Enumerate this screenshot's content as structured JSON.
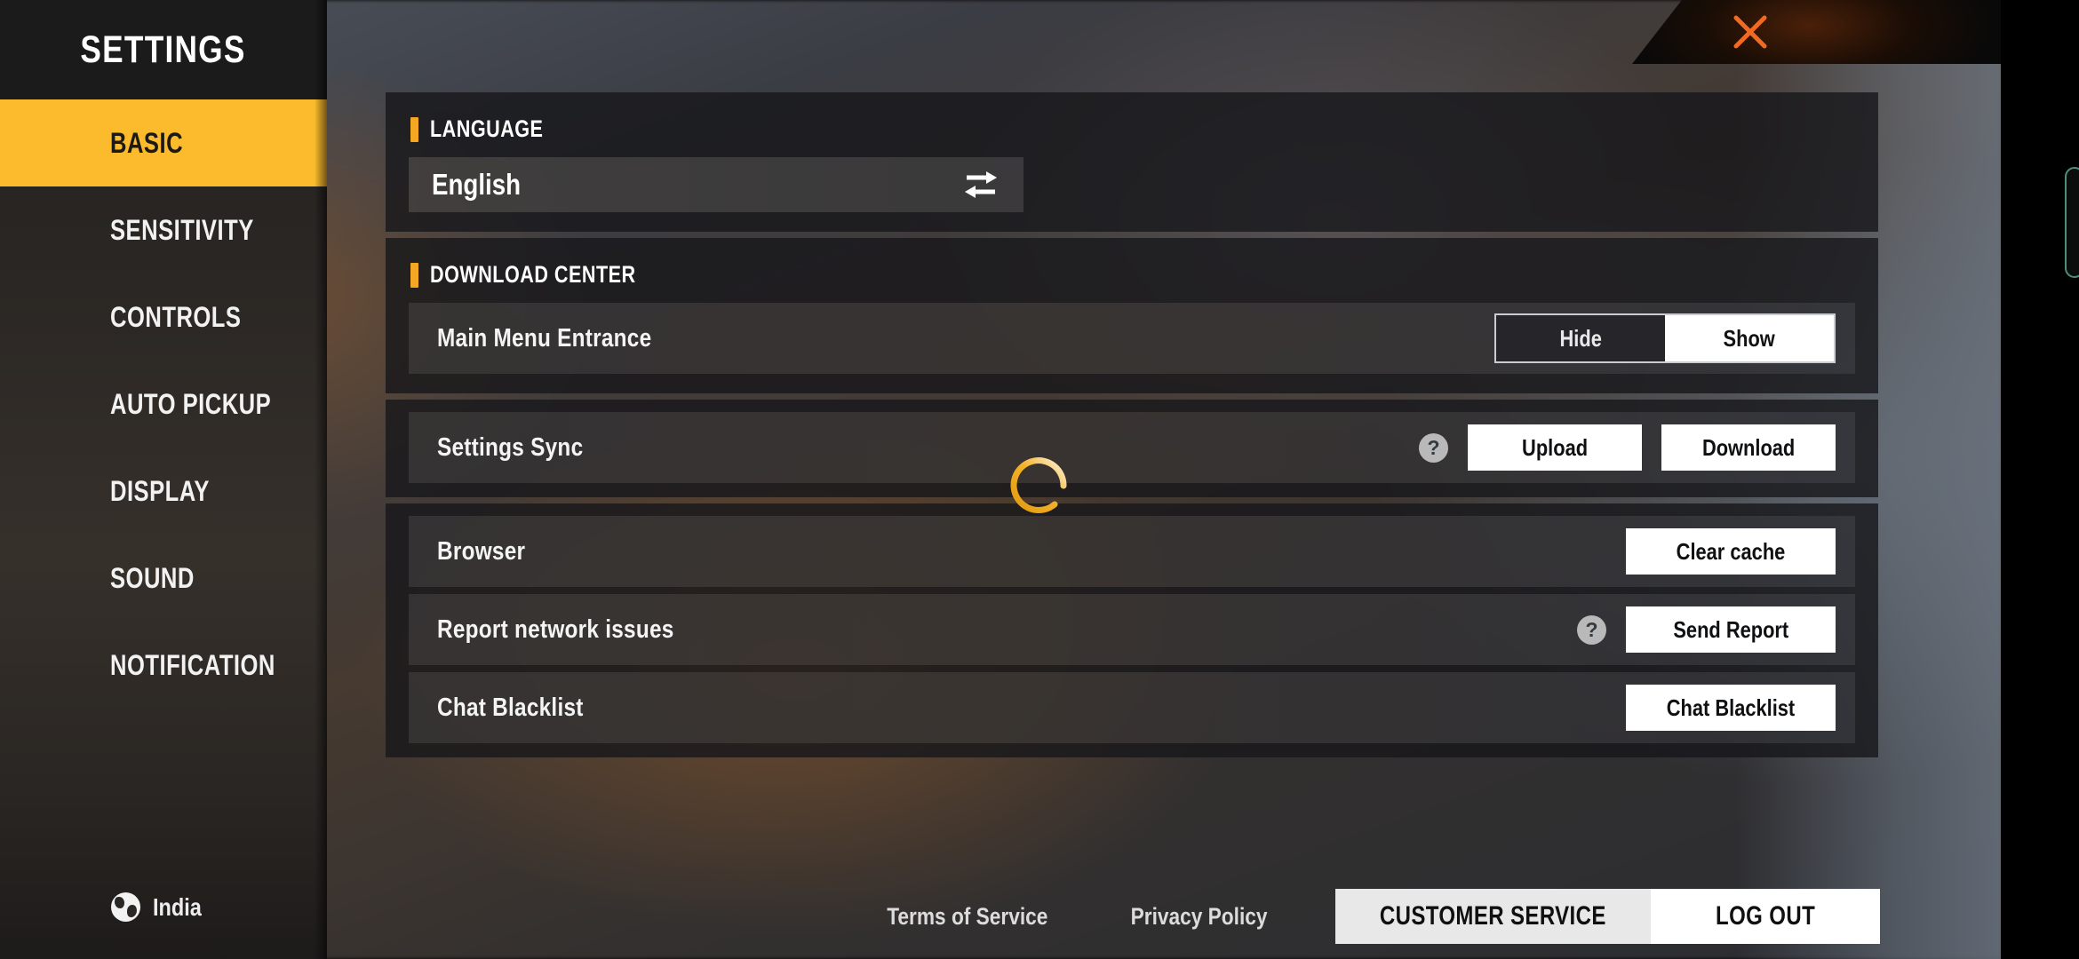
{
  "window": {
    "title": "SETTINGS",
    "close_icon": "close-x-icon",
    "accent_color": "#fbbb2c",
    "close_color": "#f26a22"
  },
  "sidebar": {
    "title": "SETTINGS",
    "items": [
      {
        "label": "BASIC",
        "active": true
      },
      {
        "label": "SENSITIVITY",
        "active": false
      },
      {
        "label": "CONTROLS",
        "active": false
      },
      {
        "label": "AUTO PICKUP",
        "active": false
      },
      {
        "label": "DISPLAY",
        "active": false
      },
      {
        "label": "SOUND",
        "active": false
      },
      {
        "label": "NOTIFICATION",
        "active": false
      }
    ],
    "region": {
      "icon": "globe-icon",
      "label": "India"
    }
  },
  "main": {
    "language_section": {
      "heading": "LANGUAGE",
      "selected_value": "English",
      "swap_icon": "swap-arrows-icon"
    },
    "download_center_section": {
      "heading": "DOWNLOAD CENTER",
      "row": {
        "label": "Main Menu Entrance",
        "options": [
          "Hide",
          "Show"
        ],
        "selected": "Show"
      }
    },
    "settings_sync_section": {
      "row_label": "Settings Sync",
      "help_icon": "question-mark-icon",
      "buttons": [
        "Upload",
        "Download"
      ]
    },
    "misc_section": {
      "rows": [
        {
          "label": "Browser",
          "button": "Clear cache",
          "help": false
        },
        {
          "label": "Report network issues",
          "button": "Send Report",
          "help": true
        },
        {
          "label": "Chat Blacklist",
          "button": "Chat Blacklist",
          "help": false
        }
      ]
    },
    "loading_spinner": {
      "icon": "loading-spinner-icon",
      "color": "#f0a92a"
    }
  },
  "footer": {
    "terms_link": "Terms of Service",
    "privacy_link": "Privacy Policy",
    "customer_service_button": "CUSTOMER SERVICE",
    "logout_button": "LOG OUT"
  }
}
